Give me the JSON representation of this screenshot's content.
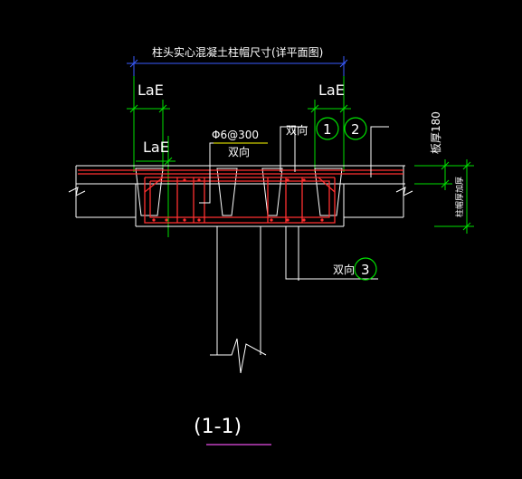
{
  "colors": {
    "background": "#000000",
    "dim_line": "#3a5cff",
    "extension": "#00e000",
    "concrete": "#ffffff",
    "rebar": "#ff3030",
    "label_yellow": "#ffff00",
    "section_underline": "#c040c0"
  },
  "labels": {
    "cap_dim": "柱头实心混凝土柱帽尺寸(详平面图)",
    "lae_left": "LaE",
    "lae_right": "LaE",
    "lae_mid": "LaE",
    "stirrup": "Φ6@300",
    "two_way_stirrup": "双向",
    "two_way_top": "双向",
    "two_way_bottom": "双向",
    "slab_thickness": "板厚180",
    "beam_depth": "柱帽厚加厚",
    "section": "(1-1)"
  },
  "markers": [
    "1",
    "2",
    "3"
  ]
}
